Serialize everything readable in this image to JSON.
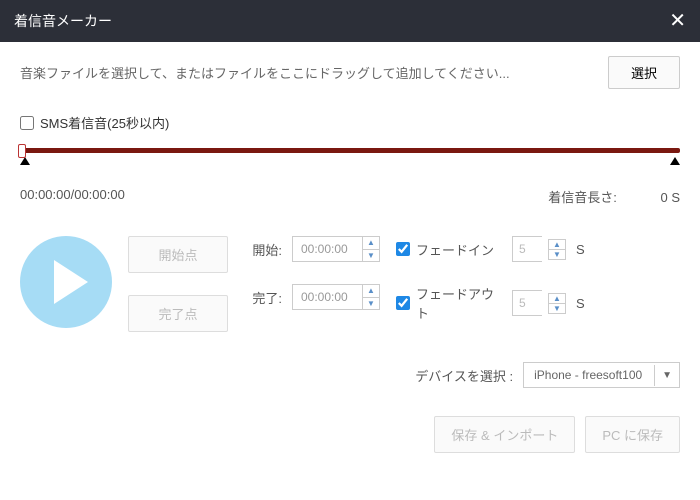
{
  "title": "着信音メーカー",
  "file_hint": "音楽ファイルを選択して、またはファイルをここにドラッグして追加してください...",
  "select_btn": "選択",
  "sms_label": "SMS着信音(25秒以内)",
  "time_display": "00:00:00/00:00:00",
  "duration_label": "着信音長さ:",
  "duration_value": "0 S",
  "points": {
    "start": "開始点",
    "end": "完了点"
  },
  "time": {
    "start_label": "開始:",
    "start_val": "00:00:00",
    "end_label": "完了:",
    "end_val": "00:00:00"
  },
  "fade": {
    "in_label": "フェードイン",
    "in_val": "5",
    "out_label": "フェードアウト",
    "out_val": "5",
    "unit": "S"
  },
  "device_label": "デバイスを選択 :",
  "device_value": "iPhone - freesoft100",
  "save_import": "保存 & インポート",
  "save_pc": "PC に保存"
}
